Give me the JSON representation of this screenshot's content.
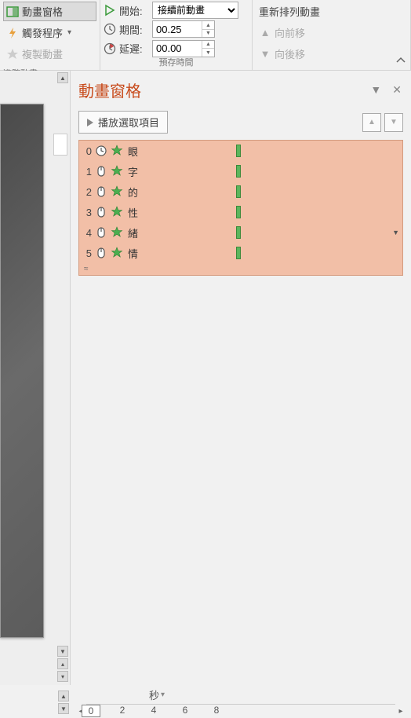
{
  "ribbon": {
    "col1": {
      "pane_btn": "動畫窗格",
      "trigger_btn": "觸發程序",
      "copy_anim_btn": "複製動畫",
      "section_label": "進階動畫"
    },
    "col2": {
      "start_label": "開始:",
      "start_value": "接續前動畫",
      "duration_label": "期間:",
      "duration_value": "00.25",
      "delay_label": "延遲:",
      "delay_value": "00.00",
      "group_label": "預存時間"
    },
    "col3": {
      "reorder_label": "重新排列動畫",
      "move_earlier": "向前移",
      "move_later": "向後移"
    }
  },
  "pane": {
    "title": "動畫窗格",
    "play_selection": "播放選取項目",
    "time_unit": "秒",
    "timeline_ticks": [
      "0",
      "2",
      "4",
      "6",
      "8"
    ],
    "items": [
      {
        "idx": "0",
        "start_type": "with_prev",
        "name": "眼"
      },
      {
        "idx": "1",
        "start_type": "on_click",
        "name": "字"
      },
      {
        "idx": "2",
        "start_type": "on_click",
        "name": "的"
      },
      {
        "idx": "3",
        "start_type": "on_click",
        "name": "性"
      },
      {
        "idx": "4",
        "start_type": "on_click",
        "name": "緒"
      },
      {
        "idx": "5",
        "start_type": "on_click",
        "name": "情"
      }
    ]
  }
}
